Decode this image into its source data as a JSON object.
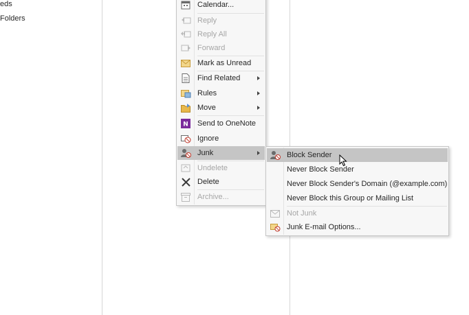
{
  "nav": {
    "items": [
      {
        "label": "eds"
      },
      {
        "label": "Folders"
      }
    ]
  },
  "context_menu": {
    "items": [
      {
        "label": "Calendar...",
        "icon": "calendar-icon",
        "enabled": true
      },
      {
        "label": "Reply",
        "icon": "reply-icon",
        "enabled": false
      },
      {
        "label": "Reply All",
        "icon": "reply-all-icon",
        "enabled": false
      },
      {
        "label": "Forward",
        "icon": "forward-icon",
        "enabled": false
      },
      {
        "label": "Mark as Unread",
        "icon": "envelope-icon",
        "enabled": true
      },
      {
        "label": "Find Related",
        "icon": "document-icon",
        "enabled": true,
        "submenu": true
      },
      {
        "label": "Rules",
        "icon": "rules-icon",
        "enabled": true,
        "submenu": true
      },
      {
        "label": "Move",
        "icon": "folder-icon",
        "enabled": true,
        "submenu": true
      },
      {
        "label": "Send to OneNote",
        "icon": "onenote-icon",
        "enabled": true
      },
      {
        "label": "Ignore",
        "icon": "ignore-icon",
        "enabled": true
      },
      {
        "label": "Junk",
        "icon": "junk-icon",
        "enabled": true,
        "submenu": true,
        "highlighted": true
      },
      {
        "label": "Undelete",
        "icon": "undelete-icon",
        "enabled": false
      },
      {
        "label": "Delete",
        "icon": "delete-icon",
        "enabled": true
      },
      {
        "label": "Archive...",
        "icon": "archive-icon",
        "enabled": false
      }
    ]
  },
  "junk_submenu": {
    "items": [
      {
        "label": "Block Sender",
        "icon": "block-sender-icon",
        "enabled": true,
        "highlighted": true
      },
      {
        "label": "Never Block Sender",
        "enabled": true
      },
      {
        "label": "Never Block Sender's Domain (@example.com)",
        "enabled": true
      },
      {
        "label": "Never Block this Group or Mailing List",
        "enabled": true
      },
      {
        "label": "Not Junk",
        "icon": "not-junk-icon",
        "enabled": false
      },
      {
        "label": "Junk E-mail Options...",
        "icon": "junk-options-icon",
        "enabled": true
      }
    ]
  },
  "colors": {
    "highlight": "#c5c5c5",
    "menu_bg": "#f7f7f7",
    "disabled_text": "#a6a6a6",
    "onenote_purple": "#7b2b9c",
    "folder_yellow": "#e8b84a"
  }
}
